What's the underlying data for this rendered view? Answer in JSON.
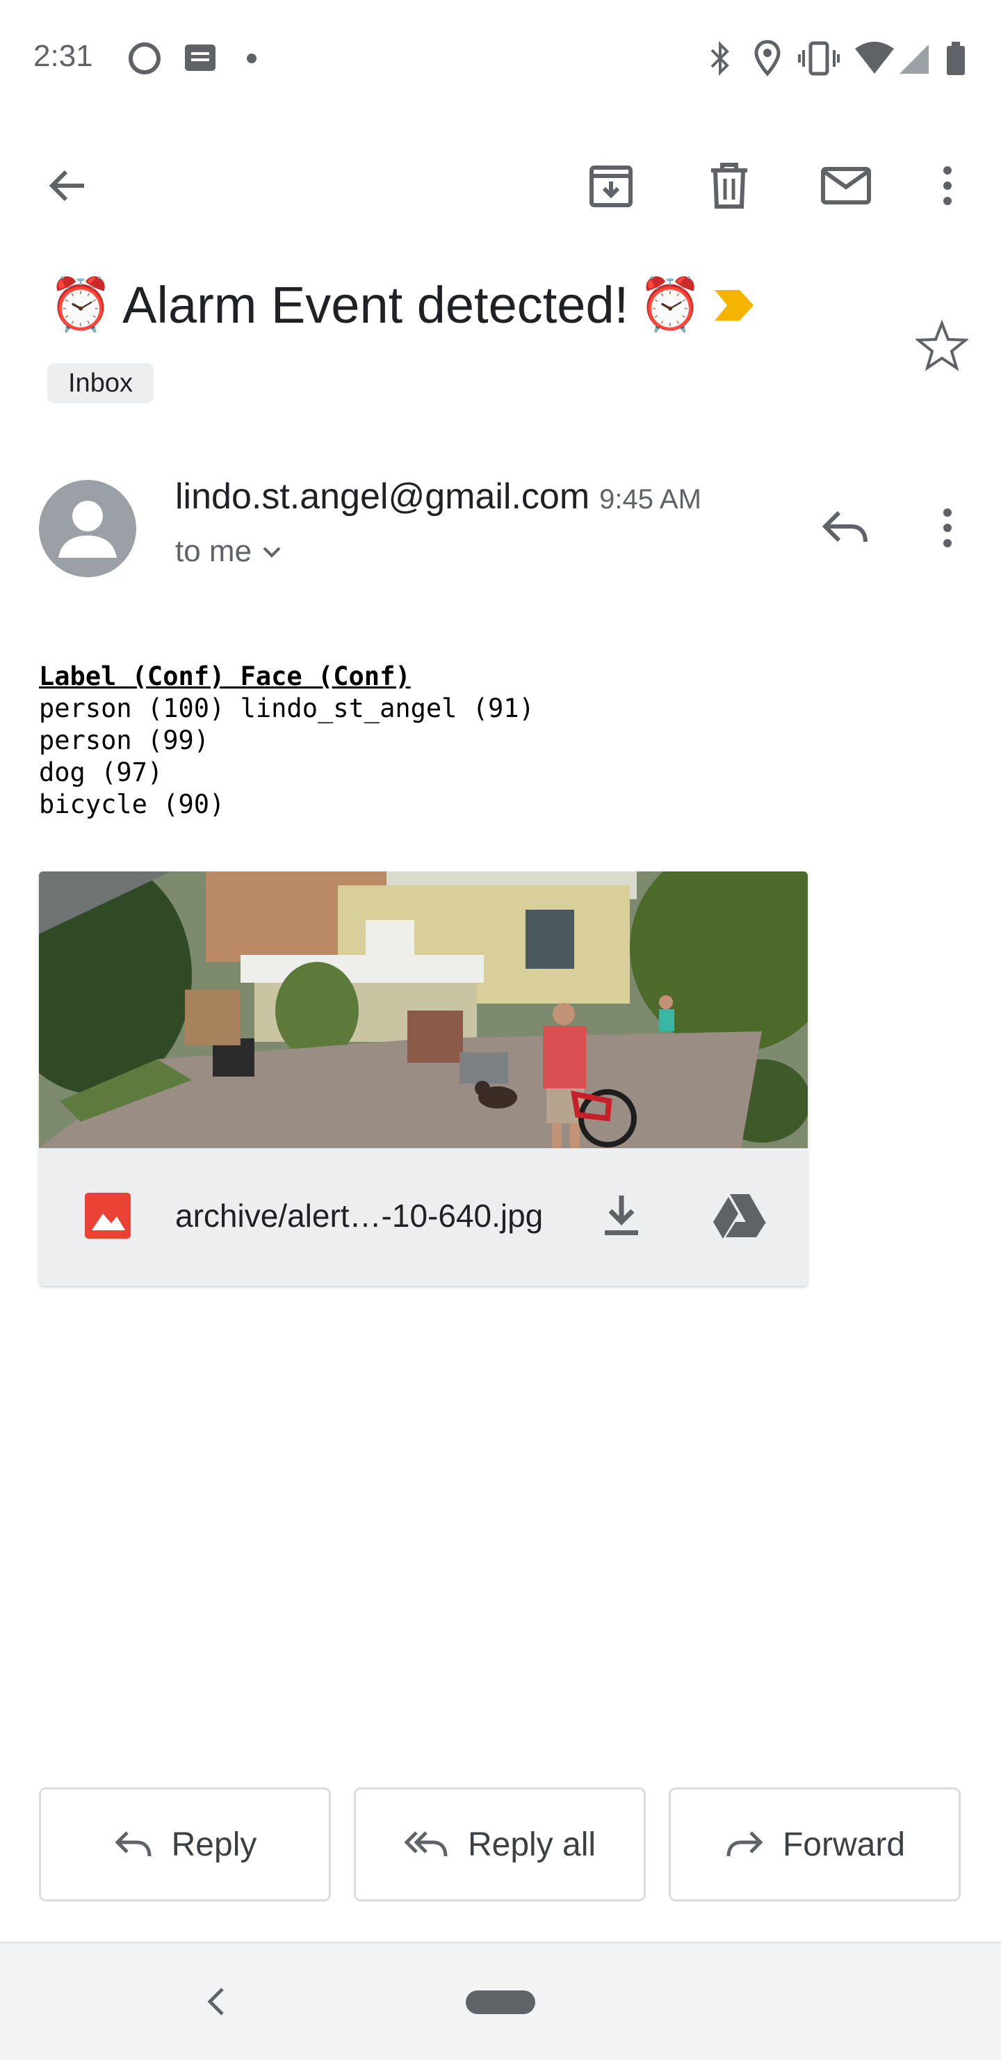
{
  "status_bar": {
    "time": "2:31",
    "left_icons": [
      "sync-circle-icon",
      "message-icon",
      "dot-icon"
    ],
    "right_icons": [
      "bluetooth-icon",
      "location-icon",
      "vibrate-icon",
      "wifi-icon",
      "signal-icon",
      "battery-icon"
    ]
  },
  "toolbar": {
    "back_icon": "arrow-back-icon",
    "archive_icon": "archive-icon",
    "delete_icon": "trash-icon",
    "mark_unread_icon": "mail-icon",
    "more_icon": "more-vert-icon"
  },
  "email": {
    "subject": "Alarm Event detected!",
    "subject_emoji": "⏰",
    "importance_color": "#f4b400",
    "label": "Inbox",
    "sender": "lindo.st.angel@gmail.com",
    "time": "9:45 AM",
    "recipient": "to me",
    "body_header": "Label (Conf) Face (Conf)",
    "body_lines": [
      "person (100) lindo_st_angel (91)",
      "person (99)",
      "dog (97)",
      "bicycle (90)"
    ],
    "attachment": {
      "filename": "archive/alert…-10-640.jpg",
      "image_icon_color": "#ea4335"
    }
  },
  "actions": {
    "reply": "Reply",
    "reply_all": "Reply all",
    "forward": "Forward"
  }
}
